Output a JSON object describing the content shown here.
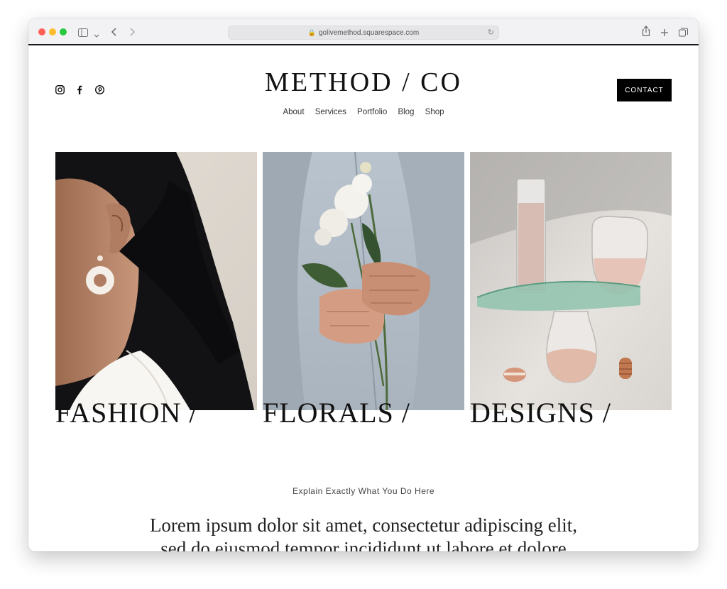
{
  "browser": {
    "url": "golivemethod.squarespace.com"
  },
  "site": {
    "logo": "METHOD / CO",
    "nav": [
      "About",
      "Services",
      "Portfolio",
      "Blog",
      "Shop"
    ],
    "contact_label": "CONTACT",
    "social_icons": [
      "instagram-icon",
      "facebook-icon",
      "pinterest-icon"
    ]
  },
  "gallery": [
    {
      "label": "FASHION /",
      "image": "woman-earring-photo"
    },
    {
      "label": "FLORALS /",
      "image": "hands-flowers-photo"
    },
    {
      "label": "DESIGNS /",
      "image": "glassware-photo"
    }
  ],
  "intro": {
    "subhead": "Explain Exactly What You Do Here",
    "line1": "Lorem ipsum dolor sit amet, consectetur adipiscing elit,",
    "line2": "sed do eiusmod tempor incididunt ut labore et dolore"
  },
  "colors": {
    "accent": "#000000",
    "traffic_red": "#fe5f57",
    "traffic_yellow": "#febc2e",
    "traffic_green": "#28c840"
  }
}
